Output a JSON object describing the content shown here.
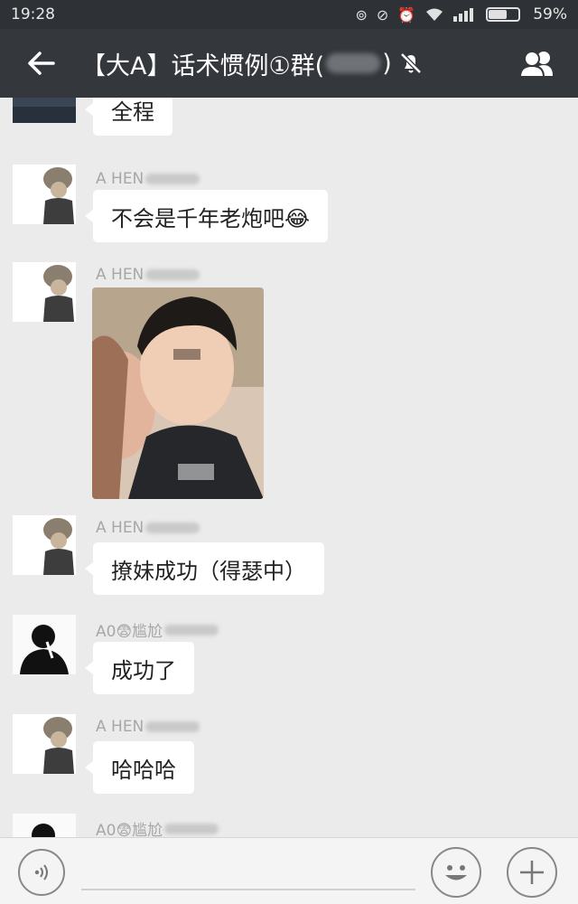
{
  "status_bar": {
    "time": "19:28",
    "battery_label": "59%",
    "battery_level": 0.59
  },
  "header": {
    "title_prefix": "【大A】话术惯例①群(",
    "title_suffix": ")"
  },
  "messages": [
    {
      "sender": "",
      "text": "全程"
    },
    {
      "sender": "A HEN",
      "text": "不会是千年老炮吧😂"
    },
    {
      "sender": "A HEN",
      "text": ""
    },
    {
      "sender": "A HEN",
      "text": "撩妹成功（得瑟中）"
    },
    {
      "sender": "A0😨尴尬",
      "text": "成功了"
    },
    {
      "sender": "A HEN",
      "text": "哈哈哈"
    },
    {
      "sender": "A0😨尴尬",
      "text": ""
    }
  ],
  "colors": {
    "status_bar_bg": "#2e3135",
    "title_bar_bg": "#34373b",
    "chat_bg": "#ebebeb",
    "bubble_bg": "#ffffff"
  },
  "icons": {
    "back": "arrow-left-icon",
    "mute": "bell-off-icon",
    "members": "group-icon",
    "voice": "voice-icon",
    "emoji": "smile-icon",
    "plus": "plus-icon"
  }
}
